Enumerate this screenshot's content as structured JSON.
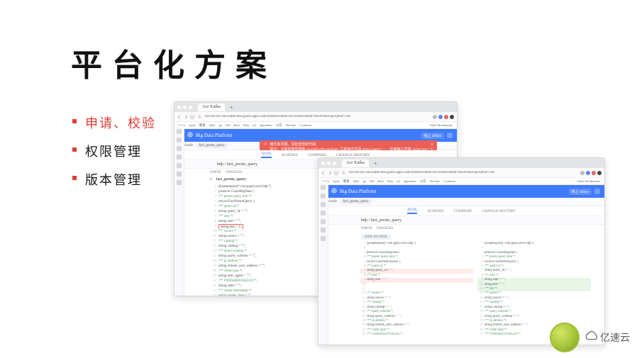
{
  "slide": {
    "title": "平台化方案",
    "bullets": [
      "申请、校验",
      "权限管理",
      "版本管理"
    ]
  },
  "browser1": {
    "tab_title": "Ace Kafka",
    "url": "Not Secure   nao-kafka-new.guazi-apps.com/schemas/detail?srcAce&schema=factPrestoQuery&id=238",
    "bookmarks": [
      "bogo",
      "study",
      "算盘",
      "daily",
      "go",
      "k8s",
      "Rust",
      "Data",
      "ml",
      "algorithm",
      "公司",
      "DevOps",
      "Continua…"
    ],
    "bookmarks_more": "Other Bookmarks",
    "brand": "Big Data Platform",
    "badge": "线上 offline",
    "crumbs": [
      "Audio",
      "fact_presto_query"
    ],
    "subtabs": [
      "AVDL",
      "SCHEMA",
      "COMPARE",
      "CHANGE HISTORY"
    ],
    "alert": {
      "line1": "格式有问题，请检查您的代码",
      "line2": "提示：不能将类型转换 recordFactPrestoQuery 工能读不字段 string source = '…' 后面缺少字段: string test = 1;"
    },
    "bdp_path": "bdp / fact_presto_query",
    "editor": {
      "tabs": [
        "WRITE",
        "CHANGES"
      ],
      "file": "fact_presto_query",
      "lines": [
        "@namespace(\"com.guazi.avro.bdp\")",
        "protocol GuaziBigData {",
        "  /** presto query info */",
        "  record FactPrestoQuery {",
        "    /** query id */",
        "    string query_id = \"\";",
        "    /** user */",
        "    string user = \"\";",
        "    string test = 1;",
        "    /** source */",
        "    string source = \"\";",
        "    /** catalog */",
        "    string catalog = \"\";",
        "    /** query schema */",
        "    string query_schema = \"\";",
        "    /** ip address */",
        "    string remote_user_address = \"\";",
        "    /** client type */",
        "    string user_agent = \"\";",
        "    /** FINISHED/FAILED */",
        "    string state = \"\";",
        "    /** create timestamp */",
        "    string create_time = \"\";"
      ],
      "highlight_idx": 8
    }
  },
  "browser2": {
    "tab_title": "Ace Kafka",
    "url": "Not Secure   nao-kafka-new.guazi-apps.com/schemas/detail?srcAce&schema=factPrestoQuery&id=238",
    "bookmarks": [
      "bogo",
      "study",
      "算盘",
      "daily",
      "go",
      "k8s",
      "Rust",
      "Data",
      "ml",
      "algorithm",
      "公司",
      "DevOps",
      "Continua…"
    ],
    "bookmarks_more": "Other Bookmarks",
    "brand": "Big Data Platform",
    "badge": "线上 offline",
    "crumbs": [
      "Audio",
      "fact_presto_query"
    ],
    "subtabs": [
      "AVDL",
      "SCHEMA",
      "COMPARE",
      "CHANGE HISTORY"
    ],
    "bdp_path": "bdp / fact_presto_query",
    "diff": {
      "tabs": [
        "WRITE",
        "CHANGES"
      ],
      "mode": "SIDE-BY-SIDE",
      "left": [
        {
          "c": "@namespace(\"com.guazi.avro.bdp\")"
        },
        {
          "c": ""
        },
        {
          "c": "protocol GuaziBigData {"
        },
        {
          "c": "  /** presto query info */"
        },
        {
          "c": "  record FactPrestoQuery {"
        },
        {
          "c": "    /** query id */"
        },
        {
          "c": "    string query_id = \"\";",
          "t": "del"
        },
        {
          "c": "    /** user */"
        },
        {
          "c": "    string user = \"\";",
          "t": "del"
        },
        {
          "c": ""
        },
        {
          "c": ""
        },
        {
          "c": "    /** source */"
        },
        {
          "c": "    string source = \"\";"
        },
        {
          "c": "    /** catalog */"
        },
        {
          "c": "    string catalog = \"\";"
        },
        {
          "c": "    /** query schema */"
        },
        {
          "c": "    string query_schema = \"\";"
        },
        {
          "c": "    /** ip address */"
        },
        {
          "c": "    string remote_user_address = \"\";"
        },
        {
          "c": "    /** client type */"
        },
        {
          "c": "    /** FINISHED/FAILED */"
        }
      ],
      "right": [
        {
          "c": "@namespace(\"com.guazi.avro.bdp\")"
        },
        {
          "c": ""
        },
        {
          "c": "protocol GuaziBigData {"
        },
        {
          "c": "  /** presto query info */"
        },
        {
          "c": "  record FactPrestoQuery {"
        },
        {
          "c": "    /** query id */"
        },
        {
          "c": "    string query_id = \"\";"
        },
        {
          "c": "    /** user */"
        },
        {
          "c": "    string user = \"\";",
          "t": "add"
        },
        {
          "c": "    string test = \"\";",
          "t": "add"
        },
        {
          "c": "    /** test */",
          "t": "add"
        },
        {
          "c": "    /** source */"
        },
        {
          "c": "    string source = \"\";"
        },
        {
          "c": "    /** catalog */"
        },
        {
          "c": "    string catalog = \"\";"
        },
        {
          "c": "    /** query schema */"
        },
        {
          "c": "    string query_schema = \"\";"
        },
        {
          "c": "    /** ip address */"
        },
        {
          "c": "    string remote_user_address = \"\";"
        },
        {
          "c": "    /** client type */"
        },
        {
          "c": "    /** FINISHED/FAILED */"
        }
      ]
    }
  },
  "watermark": "亿速云"
}
